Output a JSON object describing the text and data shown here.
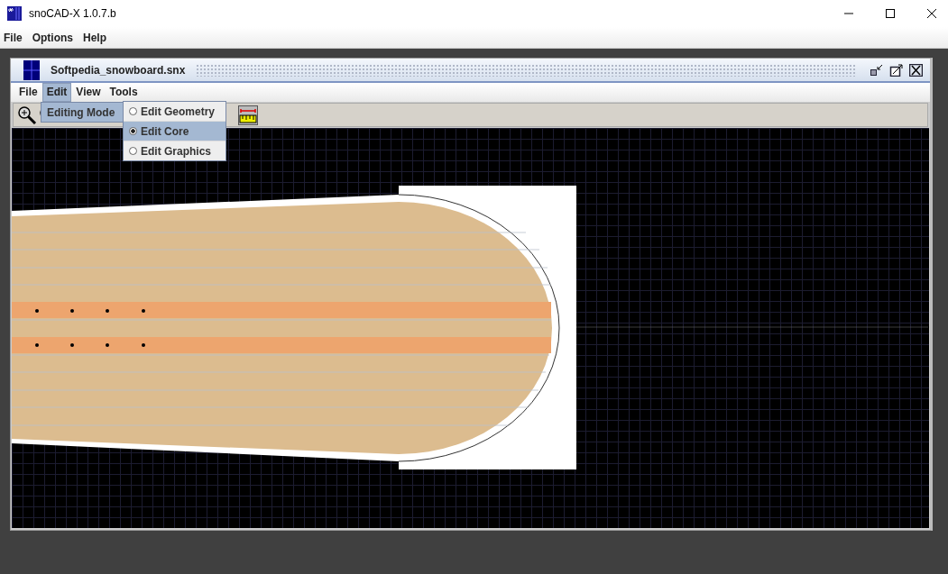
{
  "window": {
    "title": "snoCAD-X 1.0.7.b"
  },
  "menu_bar": [
    {
      "label": "File"
    },
    {
      "label": "Options"
    },
    {
      "label": "Help"
    }
  ],
  "document": {
    "title": "Softpedia_snowboard.snx",
    "menus": [
      {
        "label": "File",
        "selected": false
      },
      {
        "label": "Edit",
        "selected": true
      },
      {
        "label": "View",
        "selected": false
      },
      {
        "label": "Tools",
        "selected": false
      }
    ],
    "edit_menu": [
      {
        "label": "Editing Mode",
        "selected": true
      }
    ],
    "editing_mode_submenu": [
      {
        "label": "Edit Geometry",
        "selected": false
      },
      {
        "label": "Edit Core",
        "selected": true
      },
      {
        "label": "Edit Graphics",
        "selected": false
      }
    ]
  }
}
